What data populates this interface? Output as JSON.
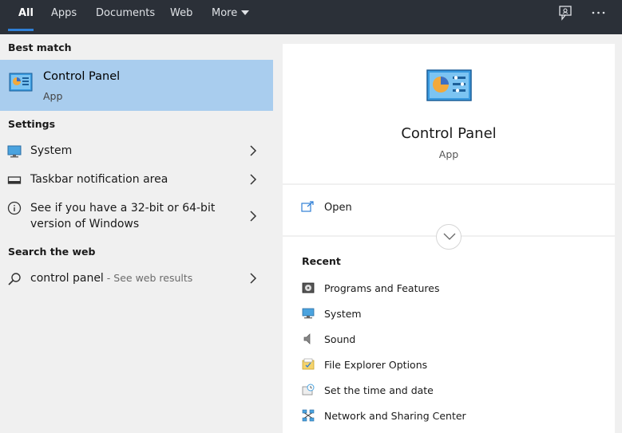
{
  "tabs": [
    {
      "label": "All",
      "active": true
    },
    {
      "label": "Apps"
    },
    {
      "label": "Documents"
    },
    {
      "label": "Web"
    },
    {
      "label": "More"
    }
  ],
  "top_icons": [
    "feedback-icon",
    "more-options-icon"
  ],
  "left": {
    "best_match_label": "Best match",
    "best_match": {
      "title": "Control Panel",
      "subtitle": "App",
      "icon": "control-panel-icon"
    },
    "settings_label": "Settings",
    "settings": [
      {
        "label": "System",
        "icon": "monitor-icon"
      },
      {
        "label": "Taskbar notification area",
        "icon": "taskbar-icon"
      },
      {
        "label_line1": "See if you have a 32-bit or 64-bit",
        "label_line2": "version of Windows",
        "icon": "info-icon"
      }
    ],
    "web_label": "Search the web",
    "web": {
      "query": "control panel",
      "hint": " - See web results",
      "icon": "search-icon"
    }
  },
  "right": {
    "title": "Control Panel",
    "subtitle": "App",
    "open_label": "Open",
    "recent_label": "Recent",
    "recent": [
      {
        "label": "Programs and Features",
        "icon": "programs-icon"
      },
      {
        "label": "System",
        "icon": "monitor-icon"
      },
      {
        "label": "Sound",
        "icon": "speaker-icon"
      },
      {
        "label": "File Explorer Options",
        "icon": "folder-options-icon"
      },
      {
        "label": "Set the time and date",
        "icon": "clock-icon"
      },
      {
        "label": "Network and Sharing Center",
        "icon": "network-icon"
      }
    ]
  },
  "colors": {
    "topbar": "#2b3038",
    "selected": "#a9cdee",
    "accent": "#2f7fd6"
  }
}
